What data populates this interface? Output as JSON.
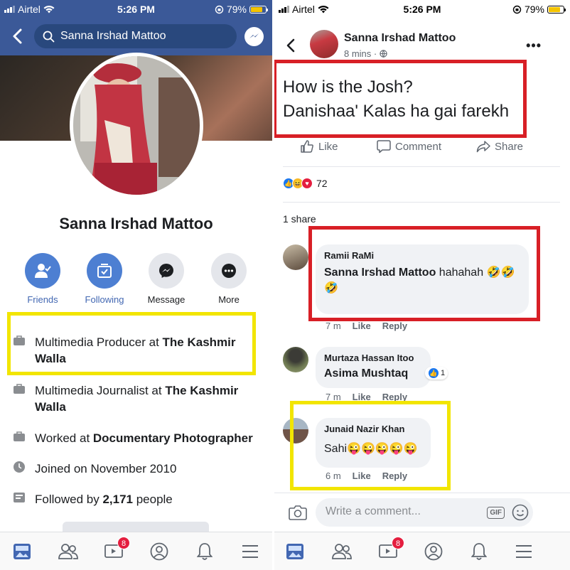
{
  "status_left": {
    "carrier": "Airtel",
    "time": "5:26 PM",
    "battery": "79%",
    "battery_level": 0.79
  },
  "status_right": {
    "carrier": "Airtel",
    "time": "5:26 PM",
    "battery": "79%",
    "battery_level": 0.79
  },
  "profile": {
    "search_text": "Sanna Irshad Mattoo",
    "name": "Sanna Irshad Mattoo",
    "actions": [
      {
        "label": "Friends",
        "icon": "friends-icon"
      },
      {
        "label": "Following",
        "icon": "following-icon"
      },
      {
        "label": "Message",
        "icon": "messenger-icon"
      },
      {
        "label": "More",
        "icon": "more-icon"
      }
    ],
    "info": [
      {
        "icon": "briefcase-icon",
        "prefix": "Multimedia Producer at ",
        "bold": "The Kashmir Walla",
        "suffix": ""
      },
      {
        "icon": "briefcase-icon",
        "prefix": "Multimedia Journalist at ",
        "bold": "The Kashmir Walla",
        "suffix": ""
      },
      {
        "icon": "briefcase-icon",
        "prefix": "Worked at ",
        "bold": "Documentary Photographer",
        "suffix": ""
      },
      {
        "icon": "clock-icon",
        "prefix": "Joined on November 2010",
        "bold": "",
        "suffix": ""
      },
      {
        "icon": "followers-icon",
        "prefix": "Followed by ",
        "bold": "2,171",
        "suffix": " people"
      }
    ],
    "tabbar_badge": "8"
  },
  "post": {
    "author": "Sanna Irshad Mattoo",
    "time": "8 mins · ",
    "text_line1": "How is the Josh?",
    "text_line2": "Danishaa' Kalas ha gai farekh",
    "like_label": "Like",
    "comment_label": "Comment",
    "share_label": "Share",
    "reaction_count": "72",
    "shares": "1 share",
    "comments": [
      {
        "name": "Ramii RaMi",
        "mention": "Sanna Irshad Mattoo",
        "text": " hahahah 🤣🤣🤣",
        "time": "7 m",
        "like": "Like",
        "reply": "Reply"
      },
      {
        "name": "Murtaza Hassan Itoo",
        "mention": "Asima Mushtaq",
        "text": "",
        "likes": "1",
        "time": "7 m",
        "like": "Like",
        "reply": "Reply"
      },
      {
        "name": "Junaid Nazir Khan",
        "mention": "",
        "text": "Sahi😜😜😜😜😜",
        "time": "6 m",
        "like": "Like",
        "reply": "Reply"
      }
    ],
    "write_placeholder": "Write a comment...",
    "gif_label": "GIF",
    "tabbar_badge": "8"
  },
  "colors": {
    "facebook_blue": "#3b5998",
    "highlight_yellow": "#f2e500",
    "highlight_red": "#d81f26",
    "badge_red": "#e41e3f"
  }
}
